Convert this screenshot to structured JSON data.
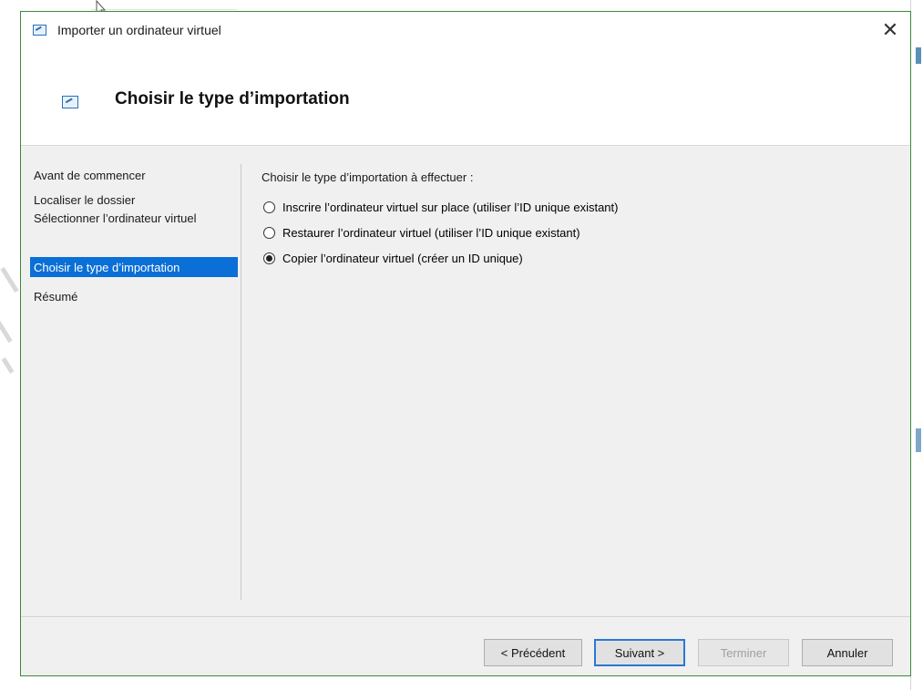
{
  "window": {
    "title": "Importer un ordinateur virtuel",
    "close_label": "✕"
  },
  "header": {
    "title": "Choisir le type d’importation",
    "icon": "import-vm-icon"
  },
  "nav": {
    "items": [
      {
        "label": "Avant de commencer",
        "active": false
      },
      {
        "label": "Localiser le dossier",
        "active": false
      },
      {
        "label": "Sélectionner l’ordinateur virtuel",
        "active": false
      },
      {
        "label": "Choisir le type d’importation",
        "active": true
      },
      {
        "label": "Résumé",
        "active": false
      }
    ]
  },
  "content": {
    "prompt": "Choisir le type d’importation à effectuer :",
    "options": [
      {
        "label": "Inscrire l’ordinateur virtuel sur place (utiliser l’ID unique existant)",
        "checked": false
      },
      {
        "label": "Restaurer l’ordinateur virtuel (utiliser l’ID unique existant)",
        "checked": false
      },
      {
        "label": "Copier l’ordinateur virtuel (créer un ID unique)",
        "checked": true
      }
    ]
  },
  "buttons": {
    "previous": "< Précédent",
    "next": "Suivant >",
    "finish": "Terminer",
    "cancel": "Annuler"
  },
  "colors": {
    "accent": "#0a6fd6",
    "window_border": "#3b8a3b"
  }
}
